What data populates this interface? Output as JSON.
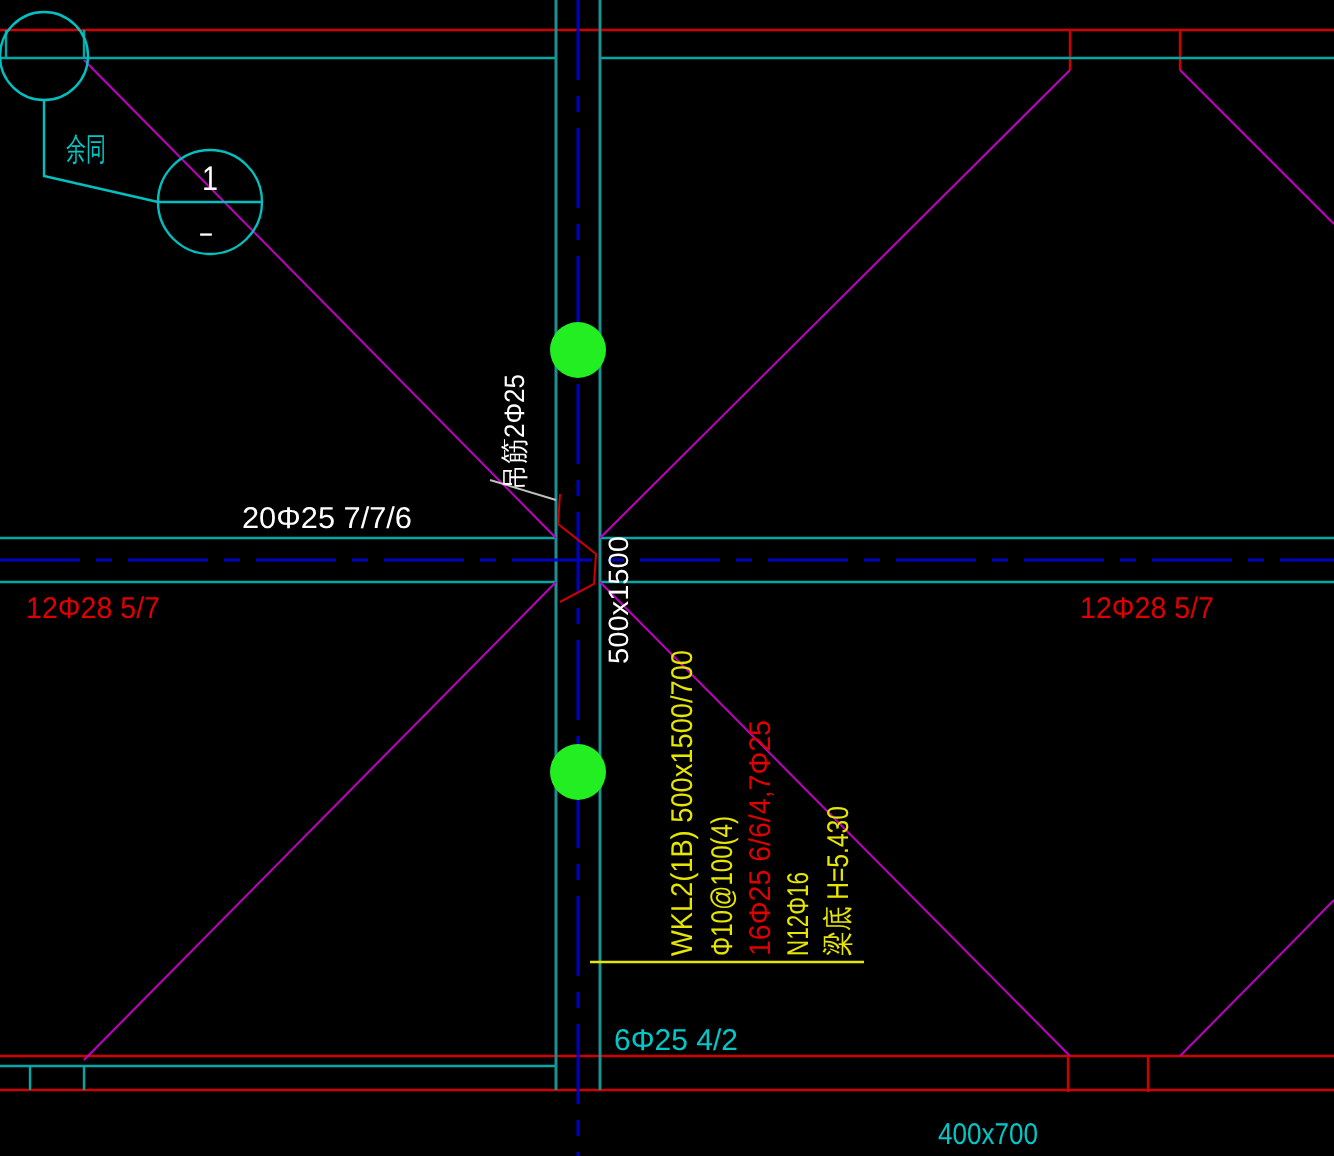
{
  "drawing": {
    "labels": [
      {
        "text": "余同",
        "color": "#00c8c8",
        "rotated": false
      },
      {
        "text": "1",
        "color": "#ffffff",
        "rotated": false
      },
      {
        "text": "-",
        "color": "#ffffff",
        "rotated": false
      },
      {
        "text": "吊筋2Φ25",
        "color": "#ffffff",
        "rotated": true
      },
      {
        "text": "20Φ25 7/7/6",
        "color": "#ffffff",
        "rotated": false
      },
      {
        "text": "500x1500",
        "color": "#ffffff",
        "rotated": true
      },
      {
        "text": "12Φ28 5/7",
        "color": "#e00000",
        "rotated": false
      },
      {
        "text": "12Φ28 5/7",
        "color": "#e00000",
        "rotated": false
      },
      {
        "text": "WKL2(1B) 500x1500/700",
        "color": "#e6e600",
        "rotated": true
      },
      {
        "text": "Φ10@100(4)",
        "color": "#e6e600",
        "rotated": true
      },
      {
        "text": "16Φ25 6/6/4,7Φ25",
        "color": "#e00000",
        "rotated": true
      },
      {
        "text": "N12Φ16",
        "color": "#e6e600",
        "rotated": true
      },
      {
        "text": "梁底 H=5.430",
        "color": "#e6e600",
        "rotated": true
      },
      {
        "text": "6Φ25 4/2",
        "color": "#00c8c8",
        "rotated": false
      },
      {
        "text": "400x700",
        "color": "#00c8c8",
        "rotated": false
      }
    ]
  }
}
